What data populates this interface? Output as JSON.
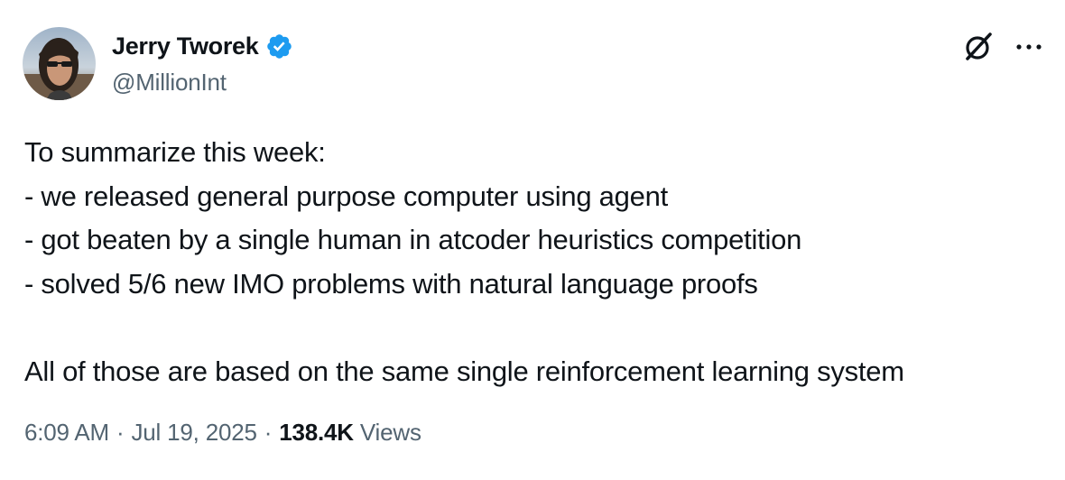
{
  "author": {
    "display_name": "Jerry Tworek",
    "handle": "@MillionInt",
    "verified": true
  },
  "icons": {
    "verified": "verified-badge-icon",
    "grok": "grok-icon",
    "more": "more-options-icon"
  },
  "colors": {
    "verified_blue": "#1d9bf0",
    "text_primary": "#0f1419",
    "text_secondary": "#536471"
  },
  "body": {
    "line1": "To summarize this week:",
    "line2": "- we released general purpose computer using agent",
    "line3": "- got beaten by a single human in atcoder heuristics competition",
    "line4": "- solved 5/6 new IMO problems with natural language proofs",
    "line5": "All of those are based on the same single reinforcement learning system"
  },
  "meta": {
    "time": "6:09 AM",
    "separator": "·",
    "date": "Jul 19, 2025",
    "views_count": "138.4K",
    "views_label": "Views"
  }
}
